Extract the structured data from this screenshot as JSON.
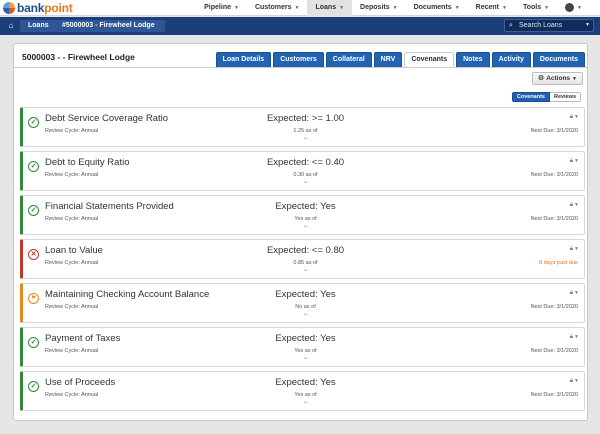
{
  "brand": {
    "name_main": "bank",
    "name_accent": "point"
  },
  "topnav": [
    {
      "label": "Pipeline",
      "active": false
    },
    {
      "label": "Customers",
      "active": false
    },
    {
      "label": "Loans",
      "active": true
    },
    {
      "label": "Deposits",
      "active": false
    },
    {
      "label": "Documents",
      "active": false
    },
    {
      "label": "Recent",
      "active": false
    },
    {
      "label": "Tools",
      "active": false
    }
  ],
  "breadcrumb": {
    "loans": "Loans",
    "loan": "#5000003 - Firewheel Lodge"
  },
  "search": {
    "placeholder": "Search Loans"
  },
  "panel": {
    "title": "5000003 - - Firewheel Lodge",
    "tabs": [
      {
        "label": "Loan Details",
        "active": false
      },
      {
        "label": "Customers",
        "active": false
      },
      {
        "label": "Collateral",
        "active": false
      },
      {
        "label": "NRV",
        "active": false
      },
      {
        "label": "Covenants",
        "active": true
      },
      {
        "label": "Notes",
        "active": false
      },
      {
        "label": "Activity",
        "active": false
      },
      {
        "label": "Documents",
        "active": false
      }
    ],
    "actions_label": "Actions",
    "toggle": {
      "covenants": "Covenants",
      "reviews": "Reviews"
    }
  },
  "covenants": [
    {
      "name": "Debt Service Coverage Ratio",
      "cycle": "Review Cycle: Annual",
      "expected": "Expected: >= 1.00",
      "actual": "1.25 as of",
      "due": "Next Due: 3/1/2020",
      "status": "ok"
    },
    {
      "name": "Debt to Equity Ratio",
      "cycle": "Review Cycle: Annual",
      "expected": "Expected: <= 0.40",
      "actual": "0.30 as of",
      "due": "Next Due: 3/1/2020",
      "status": "ok"
    },
    {
      "name": "Financial Statements Provided",
      "cycle": "Review Cycle: Annual",
      "expected": "Expected: Yes",
      "actual": "Yes as of",
      "due": "Next Due: 3/1/2020",
      "status": "ok"
    },
    {
      "name": "Loan to Value",
      "cycle": "Review Cycle: Annual",
      "expected": "Expected: <= 0.80",
      "actual": "0.85 as of",
      "due": "8 days past due",
      "status": "danger"
    },
    {
      "name": "Maintaining Checking Account Balance",
      "cycle": "Review Cycle: Annual",
      "expected": "Expected: Yes",
      "actual": "No as of",
      "due": "Next Due: 3/1/2020",
      "status": "warning"
    },
    {
      "name": "Payment of Taxes",
      "cycle": "Review Cycle: Annual",
      "expected": "Expected: Yes",
      "actual": "Yes as of",
      "due": "Next Due: 3/1/2020",
      "status": "ok"
    },
    {
      "name": "Use of Proceeds",
      "cycle": "Review Cycle: Annual",
      "expected": "Expected: Yes",
      "actual": "Yes as of",
      "due": "Next Due: 3/1/2020",
      "status": "ok"
    }
  ],
  "colors": {
    "nav_blue": "#1c3e7a",
    "tab_blue": "#2264b4",
    "ok": "#2f8a3c",
    "danger": "#c0392b",
    "warning": "#e58a1f"
  },
  "icons": {
    "ok": "check-circle-icon",
    "danger": "x-circle-icon",
    "warning": "flag-circle-icon"
  }
}
